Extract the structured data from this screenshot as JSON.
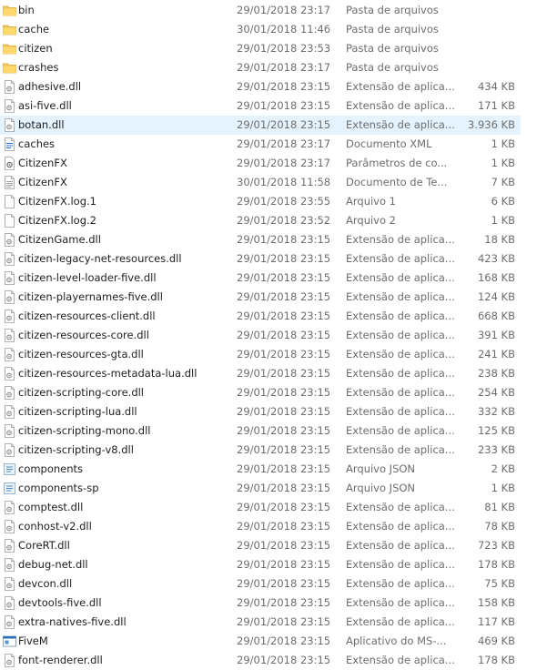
{
  "files": [
    {
      "name": "bin",
      "date": "29/01/2018 23:17",
      "type": "Pasta de arquivos",
      "size": "",
      "icon": "folder-icon"
    },
    {
      "name": "cache",
      "date": "30/01/2018 11:46",
      "type": "Pasta de arquivos",
      "size": "",
      "icon": "folder-icon"
    },
    {
      "name": "citizen",
      "date": "29/01/2018 23:53",
      "type": "Pasta de arquivos",
      "size": "",
      "icon": "folder-icon"
    },
    {
      "name": "crashes",
      "date": "29/01/2018 23:17",
      "type": "Pasta de arquivos",
      "size": "",
      "icon": "folder-icon"
    },
    {
      "name": "adhesive.dll",
      "date": "29/01/2018 23:15",
      "type": "Extensão de aplica...",
      "size": "434 KB",
      "icon": "dll-icon"
    },
    {
      "name": "asi-five.dll",
      "date": "29/01/2018 23:15",
      "type": "Extensão de aplica...",
      "size": "171 KB",
      "icon": "dll-icon"
    },
    {
      "name": "botan.dll",
      "date": "29/01/2018 23:15",
      "type": "Extensão de aplica...",
      "size": "3.936 KB",
      "icon": "dll-icon",
      "selected": true
    },
    {
      "name": "caches",
      "date": "29/01/2018 23:17",
      "type": "Documento XML",
      "size": "1 KB",
      "icon": "xml-file-icon"
    },
    {
      "name": "CitizenFX",
      "date": "29/01/2018 23:17",
      "type": "Parâmetros de co...",
      "size": "1 KB",
      "icon": "config-file-icon"
    },
    {
      "name": "CitizenFX",
      "date": "30/01/2018 11:58",
      "type": "Documento de Te...",
      "size": "7 KB",
      "icon": "text-file-icon"
    },
    {
      "name": "CitizenFX.log.1",
      "date": "29/01/2018 23:55",
      "type": "Arquivo 1",
      "size": "6 KB",
      "icon": "file-icon"
    },
    {
      "name": "CitizenFX.log.2",
      "date": "29/01/2018 23:52",
      "type": "Arquivo 2",
      "size": "1 KB",
      "icon": "file-icon"
    },
    {
      "name": "CitizenGame.dll",
      "date": "29/01/2018 23:15",
      "type": "Extensão de aplica...",
      "size": "18 KB",
      "icon": "dll-icon"
    },
    {
      "name": "citizen-legacy-net-resources.dll",
      "date": "29/01/2018 23:15",
      "type": "Extensão de aplica...",
      "size": "423 KB",
      "icon": "dll-icon"
    },
    {
      "name": "citizen-level-loader-five.dll",
      "date": "29/01/2018 23:15",
      "type": "Extensão de aplica...",
      "size": "168 KB",
      "icon": "dll-icon"
    },
    {
      "name": "citizen-playernames-five.dll",
      "date": "29/01/2018 23:15",
      "type": "Extensão de aplica...",
      "size": "124 KB",
      "icon": "dll-icon"
    },
    {
      "name": "citizen-resources-client.dll",
      "date": "29/01/2018 23:15",
      "type": "Extensão de aplica...",
      "size": "668 KB",
      "icon": "dll-icon"
    },
    {
      "name": "citizen-resources-core.dll",
      "date": "29/01/2018 23:15",
      "type": "Extensão de aplica...",
      "size": "391 KB",
      "icon": "dll-icon"
    },
    {
      "name": "citizen-resources-gta.dll",
      "date": "29/01/2018 23:15",
      "type": "Extensão de aplica...",
      "size": "241 KB",
      "icon": "dll-icon"
    },
    {
      "name": "citizen-resources-metadata-lua.dll",
      "date": "29/01/2018 23:15",
      "type": "Extensão de aplica...",
      "size": "238 KB",
      "icon": "dll-icon"
    },
    {
      "name": "citizen-scripting-core.dll",
      "date": "29/01/2018 23:15",
      "type": "Extensão de aplica...",
      "size": "254 KB",
      "icon": "dll-icon"
    },
    {
      "name": "citizen-scripting-lua.dll",
      "date": "29/01/2018 23:15",
      "type": "Extensão de aplica...",
      "size": "332 KB",
      "icon": "dll-icon"
    },
    {
      "name": "citizen-scripting-mono.dll",
      "date": "29/01/2018 23:15",
      "type": "Extensão de aplica...",
      "size": "125 KB",
      "icon": "dll-icon"
    },
    {
      "name": "citizen-scripting-v8.dll",
      "date": "29/01/2018 23:15",
      "type": "Extensão de aplica...",
      "size": "233 KB",
      "icon": "dll-icon"
    },
    {
      "name": "components",
      "date": "29/01/2018 23:15",
      "type": "Arquivo JSON",
      "size": "2 KB",
      "icon": "json-file-icon"
    },
    {
      "name": "components-sp",
      "date": "29/01/2018 23:15",
      "type": "Arquivo JSON",
      "size": "1 KB",
      "icon": "json-file-icon"
    },
    {
      "name": "comptest.dll",
      "date": "29/01/2018 23:15",
      "type": "Extensão de aplica...",
      "size": "81 KB",
      "icon": "dll-icon"
    },
    {
      "name": "conhost-v2.dll",
      "date": "29/01/2018 23:15",
      "type": "Extensão de aplica...",
      "size": "78 KB",
      "icon": "dll-icon"
    },
    {
      "name": "CoreRT.dll",
      "date": "29/01/2018 23:15",
      "type": "Extensão de aplica...",
      "size": "723 KB",
      "icon": "dll-icon"
    },
    {
      "name": "debug-net.dll",
      "date": "29/01/2018 23:15",
      "type": "Extensão de aplica...",
      "size": "178 KB",
      "icon": "dll-icon"
    },
    {
      "name": "devcon.dll",
      "date": "29/01/2018 23:15",
      "type": "Extensão de aplica...",
      "size": "75 KB",
      "icon": "dll-icon"
    },
    {
      "name": "devtools-five.dll",
      "date": "29/01/2018 23:15",
      "type": "Extensão de aplica...",
      "size": "158 KB",
      "icon": "dll-icon"
    },
    {
      "name": "extra-natives-five.dll",
      "date": "29/01/2018 23:15",
      "type": "Extensão de aplica...",
      "size": "117 KB",
      "icon": "dll-icon"
    },
    {
      "name": "FiveM",
      "date": "29/01/2018 23:15",
      "type": "Aplicativo do MS-...",
      "size": "469 KB",
      "icon": "app-icon"
    },
    {
      "name": "font-renderer.dll",
      "date": "29/01/2018 23:15",
      "type": "Extensão de aplica...",
      "size": "178 KB",
      "icon": "dll-icon"
    }
  ]
}
